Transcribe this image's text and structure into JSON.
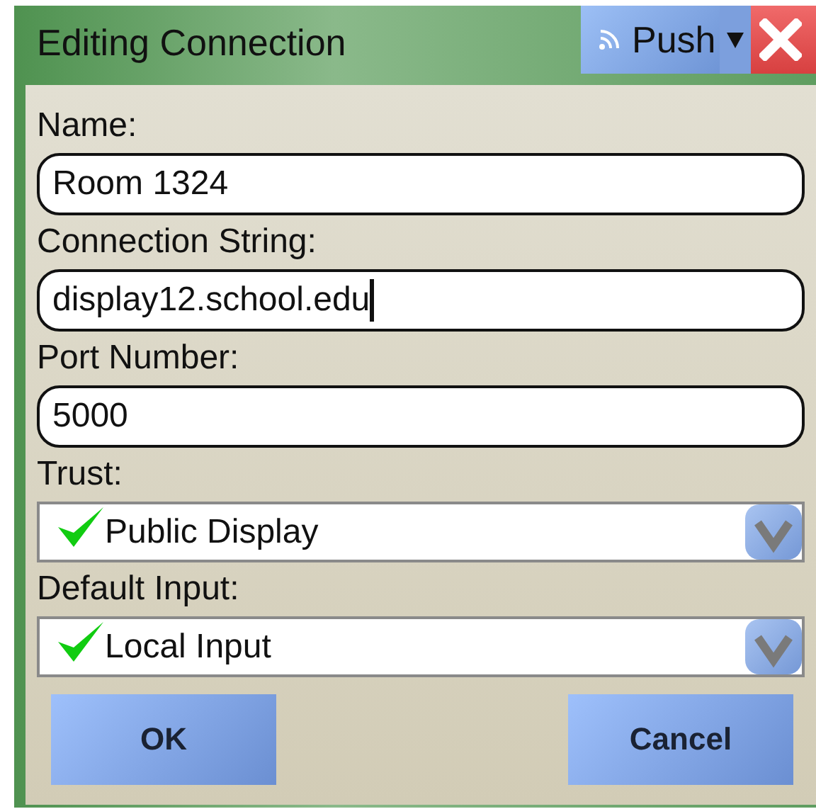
{
  "window": {
    "title": "Editing Connection"
  },
  "push_button": {
    "label": "Push"
  },
  "fields": [
    {
      "kind": "text",
      "label": "Name:",
      "value": "Room 1324",
      "focused": false
    },
    {
      "kind": "text",
      "label": "Connection String:",
      "value": "display12.school.edu",
      "focused": true
    },
    {
      "kind": "text",
      "label": "Port Number:",
      "value": "5000",
      "focused": false
    },
    {
      "kind": "select",
      "label": "Trust:",
      "value": "Public Display",
      "checked": true
    },
    {
      "kind": "select",
      "label": "Default Input:",
      "value": "Local Input",
      "checked": true
    }
  ],
  "buttons": [
    "OK",
    "Cancel"
  ]
}
